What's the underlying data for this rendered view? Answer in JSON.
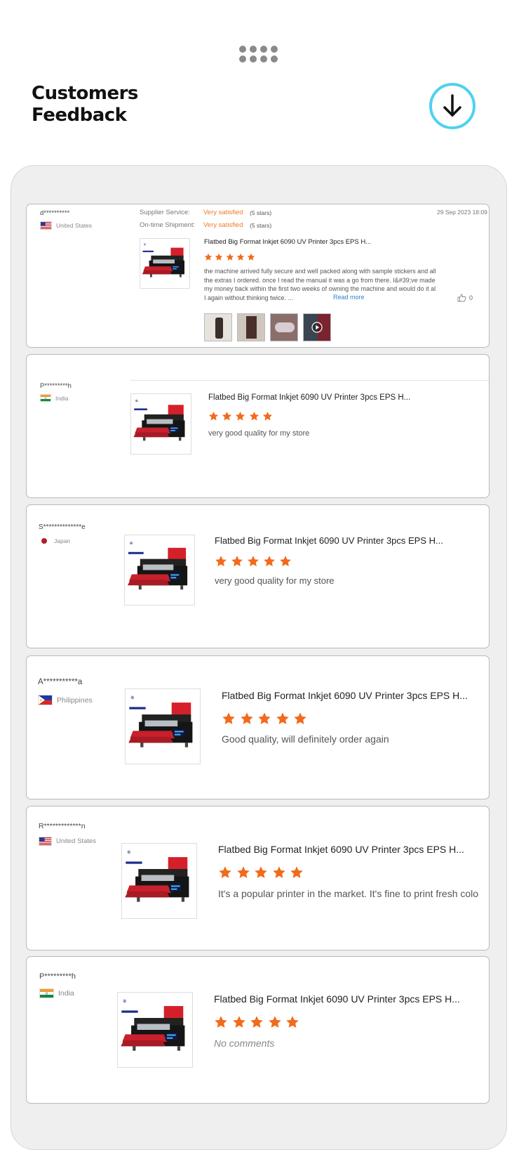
{
  "header": {
    "title_line1": "Customers",
    "title_line2": "Feedback"
  },
  "icons": {
    "menu": "grid-dots-icon",
    "download": "download-arrow-icon",
    "like": "thumbs-up-icon",
    "play": "play-icon"
  },
  "colors": {
    "accent_ring": "#4fd1f0",
    "star": "#f26a1b",
    "satisfied": "#f07a2a",
    "link": "#2f7fd1"
  },
  "reviews": [
    {
      "name": "d**********",
      "country": "United States",
      "supplier_label": "Supplier Service:",
      "supplier_value": "Very satisfied",
      "supplier_count": "(5 stars)",
      "shipment_label": "On-time Shipment:",
      "shipment_value": "Very satisfied",
      "shipment_count": "(5 stars)",
      "date": "29 Sep 2023 18:09",
      "product": "Flatbed Big Format Inkjet 6090 UV Printer 3pcs EPS H...",
      "rating": 5,
      "comment_lines": [
        "the machine arrived fully secure and well packed along with sample stickers and all",
        "the extras I ordered. once I read the manual it was a go from there. I&#39;ve made",
        "my money back within the first two weeks of owning the machine and would do it al",
        "I again without thinking twice. ..."
      ],
      "read_more": "Read more",
      "likes": "0"
    },
    {
      "name": "P*********h",
      "country": "India",
      "product": "Flatbed Big Format Inkjet 6090 UV Printer 3pcs EPS H...",
      "rating": 5,
      "comment": "very good quality for my store"
    },
    {
      "name": "S**************e",
      "country": "Japan",
      "product": "Flatbed Big Format Inkjet 6090 UV Printer 3pcs EPS H...",
      "rating": 5,
      "comment": "very good quality for my store"
    },
    {
      "name": "A***********a",
      "country": "Philippines",
      "product": "Flatbed Big Format Inkjet 6090 UV Printer 3pcs EPS H...",
      "rating": 5,
      "comment": "Good quality, will definitely order again"
    },
    {
      "name": "R*************n",
      "country": "United States",
      "product": "Flatbed Big Format Inkjet 6090 UV Printer 3pcs EPS H...",
      "rating": 5,
      "comment": "It's a popular printer in the market. It's fine to print fresh colo"
    },
    {
      "name": "P*********h",
      "country": "India",
      "product": "Flatbed Big Format Inkjet 6090 UV Printer 3pcs EPS H...",
      "rating": 5,
      "comment": "No comments"
    }
  ]
}
